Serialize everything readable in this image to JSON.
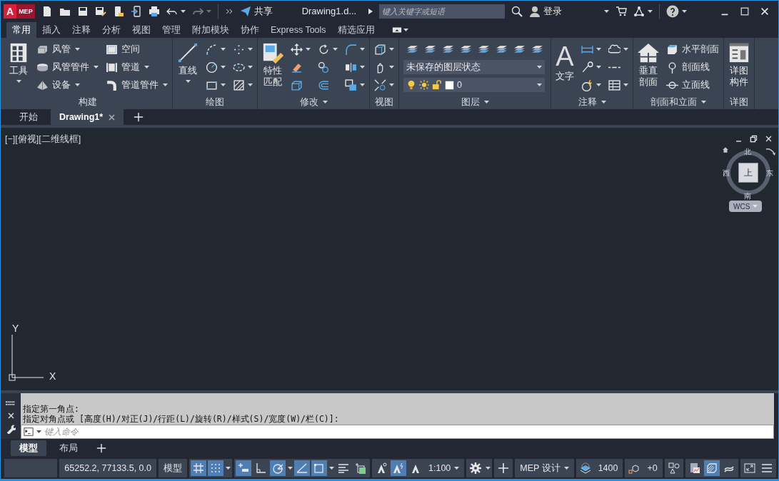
{
  "title_bar": {
    "logo_letter": "A",
    "product": "MEP",
    "share": "共享",
    "document_title": "Drawing1.d...",
    "search": {
      "placeholder": "键入关键字或短语"
    },
    "sign_in": "登录"
  },
  "ribbon_tabs": [
    {
      "label": "常用",
      "selected": true
    },
    {
      "label": "插入",
      "selected": false
    },
    {
      "label": "注释",
      "selected": false
    },
    {
      "label": "分析",
      "selected": false
    },
    {
      "label": "视图",
      "selected": false
    },
    {
      "label": "管理",
      "selected": false
    },
    {
      "label": "附加模块",
      "selected": false
    },
    {
      "label": "协作",
      "selected": false
    },
    {
      "label": "Express Tools",
      "selected": false
    },
    {
      "label": "精选应用",
      "selected": false
    }
  ],
  "ribbon_panels": [
    {
      "title": "构建",
      "menu": false,
      "columns": [
        [
          {
            "kind": "large",
            "label": "工具",
            "dropdown": true
          }
        ],
        [
          {
            "kind": "small",
            "label": "风管",
            "dropdown": true
          },
          {
            "kind": "small",
            "label": "风管管件",
            "dropdown": true
          },
          {
            "kind": "small",
            "label": "设备",
            "dropdown": true
          }
        ],
        [
          {
            "kind": "small",
            "label": "空间",
            "dropdown": false
          },
          {
            "kind": "small",
            "label": "管道",
            "dropdown": true
          },
          {
            "kind": "small",
            "label": "管道管件",
            "dropdown": true
          }
        ]
      ]
    },
    {
      "title": "绘图",
      "menu": false,
      "columns": [
        [
          {
            "kind": "large",
            "label": "直线",
            "dropdown": true
          }
        ],
        [
          {
            "kind": "icon",
            "dropdown": true
          },
          {
            "kind": "icon",
            "dropdown": true
          },
          {
            "kind": "icon",
            "dropdown": true
          }
        ],
        [
          {
            "kind": "icon",
            "dropdown": true
          },
          {
            "kind": "icon",
            "dropdown": true
          },
          {
            "kind": "icon",
            "dropdown": true
          }
        ]
      ]
    },
    {
      "title": "修改",
      "menu": true,
      "columns": [
        [
          {
            "kind": "large",
            "label": "特性匹配",
            "dropdown": false
          }
        ],
        [
          {
            "kind": "icon",
            "dropdown": true
          },
          {
            "kind": "icon",
            "dropdown": false
          },
          {
            "kind": "icon",
            "dropdown": false
          }
        ],
        [
          {
            "kind": "icon",
            "dropdown": true
          },
          {
            "kind": "icon",
            "dropdown": false
          },
          {
            "kind": "icon",
            "dropdown": false
          }
        ],
        [
          {
            "kind": "icon",
            "dropdown": true
          },
          {
            "kind": "icon",
            "dropdown": true
          },
          {
            "kind": "icon",
            "dropdown": true
          }
        ]
      ]
    },
    {
      "title": "视图",
      "menu": false,
      "columns": [
        [
          {
            "kind": "icon",
            "dropdown": true
          },
          {
            "kind": "icon",
            "dropdown": true
          },
          {
            "kind": "icon",
            "dropdown": true
          }
        ]
      ]
    },
    {
      "title": "图层",
      "menu": true,
      "columns": [
        [
          {
            "kind": "strip",
            "buttons": [
              {
                "dropdown": false
              },
              {
                "dropdown": false
              },
              {
                "dropdown": false
              },
              {
                "dropdown": false
              },
              {
                "dropdown": false
              },
              {
                "dropdown": false
              },
              {
                "dropdown": false
              },
              {
                "dropdown": false
              }
            ]
          },
          {
            "kind": "combo",
            "value": "未保存的图层状态",
            "dropdown": true
          },
          {
            "kind": "layer_combo",
            "value": "0",
            "dropdown": true
          }
        ]
      ]
    },
    {
      "title": "注释",
      "menu": true,
      "columns": [
        [
          {
            "kind": "glyph",
            "glyph": "A",
            "label": "文字",
            "dropdown": false
          }
        ],
        [
          {
            "kind": "icon",
            "dropdown": true
          },
          {
            "kind": "icon",
            "dropdown": true
          },
          {
            "kind": "icon",
            "dropdown": true
          }
        ],
        [
          {
            "kind": "icon",
            "dropdown": true
          },
          {
            "kind": "icon",
            "dropdown": false
          },
          {
            "kind": "icon",
            "dropdown": true
          }
        ]
      ]
    },
    {
      "title": "剖面和立面",
      "menu": true,
      "columns": [
        [
          {
            "kind": "large",
            "label": "垂直剖面",
            "dropdown": false
          }
        ],
        [
          {
            "kind": "small",
            "label": "水平剖面",
            "dropdown": false
          },
          {
            "kind": "small",
            "label": "剖面线",
            "dropdown": false
          },
          {
            "kind": "small",
            "label": "立面线",
            "dropdown": false
          }
        ]
      ]
    },
    {
      "title": "详图",
      "menu": false,
      "columns": [
        [
          {
            "kind": "large",
            "label": "详图构件",
            "dropdown": false
          }
        ]
      ]
    }
  ],
  "file_tabs": [
    {
      "label": "开始",
      "selected": false,
      "closable": false
    },
    {
      "label": "Drawing1*",
      "selected": true,
      "closable": true
    }
  ],
  "viewport": {
    "label": "[−][俯视][二维线框]",
    "viewcube": {
      "north": "北",
      "south": "南",
      "east": "东",
      "west": "西",
      "face": "上",
      "ucs_menu": "WCS"
    },
    "ucs": {
      "y": "Y",
      "x": "X"
    }
  },
  "command_line": {
    "history": [
      "指定第一角点:",
      "指定对角点或 [高度(H)/对正(J)/行距(L)/旋转(R)/样式(S)/宽度(W)/栏(C)]:"
    ],
    "placeholder": "键入命令"
  },
  "layout_tabs": [
    {
      "label": "模型",
      "selected": true
    },
    {
      "label": "布局",
      "selected": false
    }
  ],
  "status_bar": [
    {
      "items": [
        {
          "kind": "blank"
        }
      ]
    },
    {
      "items": [
        {
          "kind": "text",
          "text": "65252.2, 77133.5, 0.0",
          "dropdown": false
        }
      ]
    },
    {
      "items": [
        {
          "kind": "text",
          "text": "模型",
          "dropdown": false
        }
      ]
    },
    {
      "items": [
        {
          "kind": "toggle",
          "on": true,
          "dropdown": false
        },
        {
          "kind": "toggle",
          "on": true,
          "dropdown": true
        }
      ]
    },
    {
      "items": [
        {
          "kind": "toggle",
          "on": true,
          "dropdown": false
        },
        {
          "kind": "toggle",
          "on": false,
          "dropdown": false
        },
        {
          "kind": "toggle",
          "on": true,
          "dropdown": true
        },
        {
          "kind": "toggle",
          "on": true,
          "dropdown": false
        },
        {
          "kind": "toggle",
          "on": true,
          "dropdown": true
        },
        {
          "kind": "toggle",
          "on": false,
          "dropdown": false
        },
        {
          "kind": "toggle",
          "on": false,
          "dropdown": false
        }
      ]
    },
    {
      "items": [
        {
          "kind": "toggle",
          "on": false,
          "dropdown": false
        },
        {
          "kind": "toggle",
          "on": true,
          "dropdown": false
        },
        {
          "kind": "toggle",
          "on": false,
          "dropdown": false
        },
        {
          "kind": "text",
          "text": "1:100",
          "dropdown": true
        }
      ]
    },
    {
      "items": [
        {
          "kind": "toggle",
          "on": false,
          "dropdown": true
        }
      ]
    },
    {
      "items": [
        {
          "kind": "toggle",
          "on": false,
          "dropdown": false
        }
      ]
    },
    {
      "items": [
        {
          "kind": "text",
          "text": "MEP 设计",
          "dropdown": true
        }
      ]
    },
    {
      "items": [
        {
          "kind": "toggle",
          "on": false,
          "dropdown": false
        },
        {
          "kind": "text",
          "text": "1400",
          "dropdown": false
        }
      ]
    },
    {
      "items": [
        {
          "kind": "toggle",
          "on": false,
          "dropdown": false
        },
        {
          "kind": "text",
          "text": "+0",
          "dropdown": false
        }
      ]
    },
    {
      "items": [
        {
          "kind": "toggle",
          "on": false,
          "dropdown": false
        }
      ]
    },
    {
      "items": [
        {
          "kind": "toggle",
          "on": false,
          "dropdown": false
        },
        {
          "kind": "toggle",
          "on": true,
          "dropdown": false
        },
        {
          "kind": "toggle",
          "on": false,
          "dropdown": false
        }
      ]
    },
    {
      "items": [
        {
          "kind": "toggle",
          "on": false,
          "dropdown": false
        },
        {
          "kind": "toggle",
          "on": false,
          "dropdown": false
        }
      ]
    }
  ]
}
